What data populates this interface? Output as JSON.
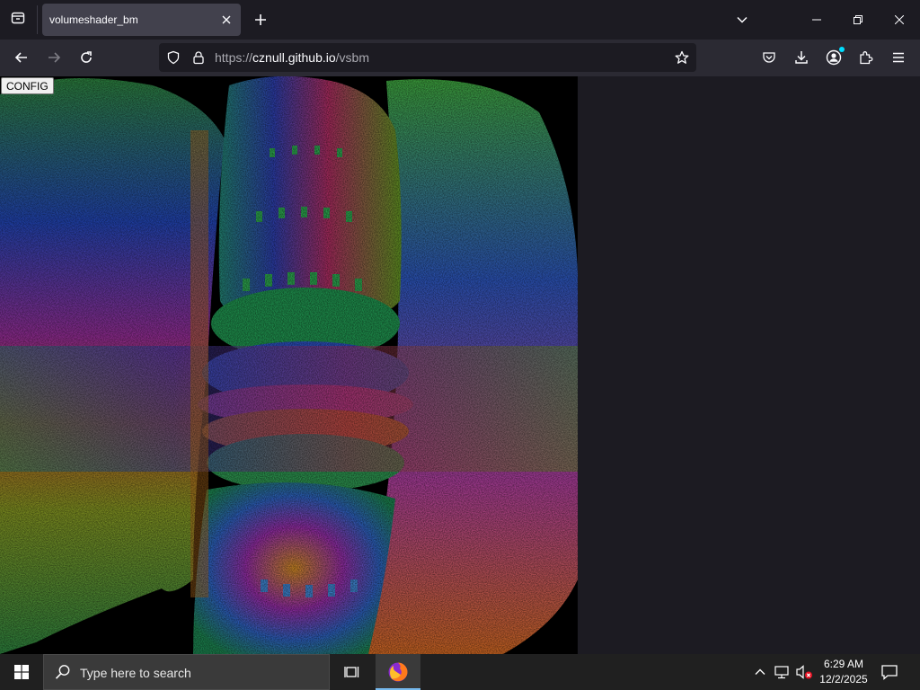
{
  "browser": {
    "tab": {
      "title": "volumeshader_bm"
    },
    "url": {
      "scheme": "https://",
      "host": "cznull.github.io",
      "path": "/vsbm"
    }
  },
  "page": {
    "config_button": "CONFIG",
    "canvas_description": "volumetric fractal render (Mandelbulb-style) with rainbow HSL coloring"
  },
  "taskbar": {
    "search_placeholder": "Type here to search",
    "time": "6:29 AM",
    "date": "12/2/2025"
  },
  "colors": {
    "tab_strip": "#1c1b22",
    "toolbar": "#2b2a33",
    "active_tab": "#42414d",
    "urlbar": "#1c1b22",
    "taskbar": "#202020",
    "accent": "#00ddff"
  }
}
